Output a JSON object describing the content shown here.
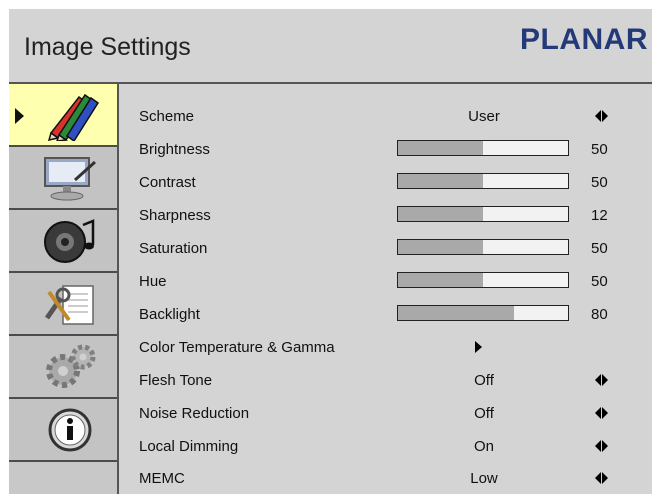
{
  "header": {
    "title": "Image Settings",
    "brand": "PLANAR"
  },
  "sidebar": {
    "items": [
      {
        "name": "image-settings",
        "icon": "color-pencils-icon",
        "active": true
      },
      {
        "name": "display-setup",
        "icon": "display-pen-icon",
        "active": false
      },
      {
        "name": "audio",
        "icon": "speaker-music-icon",
        "active": false
      },
      {
        "name": "tools",
        "icon": "tools-document-icon",
        "active": false
      },
      {
        "name": "system",
        "icon": "gears-icon",
        "active": false
      },
      {
        "name": "information",
        "icon": "info-icon",
        "active": false
      }
    ]
  },
  "settings": [
    {
      "label": "Scheme",
      "type": "option",
      "value": "User"
    },
    {
      "label": "Brightness",
      "type": "slider",
      "value": "50",
      "level": 0.5
    },
    {
      "label": "Contrast",
      "type": "slider",
      "value": "50",
      "level": 0.5
    },
    {
      "label": "Sharpness",
      "type": "slider",
      "value": "12",
      "level": 0.5
    },
    {
      "label": "Saturation",
      "type": "slider",
      "value": "50",
      "level": 0.5
    },
    {
      "label": "Hue",
      "type": "slider",
      "value": "50",
      "level": 0.5
    },
    {
      "label": "Backlight",
      "type": "slider",
      "value": "80",
      "level": 0.68
    },
    {
      "label": "Color Temperature & Gamma",
      "type": "submenu"
    },
    {
      "label": "Flesh Tone",
      "type": "option",
      "value": "Off"
    },
    {
      "label": "Noise Reduction",
      "type": "option",
      "value": "Off"
    },
    {
      "label": "Local Dimming",
      "type": "option",
      "value": "On"
    },
    {
      "label": "MEMC",
      "type": "option",
      "value": "Low"
    }
  ],
  "colors": {
    "active_highlight": "#ffffb0",
    "background": "#d4d4d4",
    "brand": "#243a78",
    "slider_fill": "#a9a9a9"
  }
}
